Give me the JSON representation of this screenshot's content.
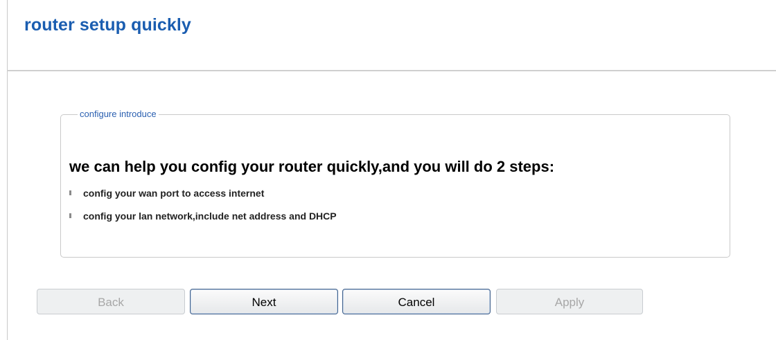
{
  "header": {
    "title": "router setup quickly"
  },
  "intro_section": {
    "legend": "configure introduce",
    "headline": "we can help you config your router quickly,and you will do 2 steps:",
    "steps": [
      "config your wan port to access internet",
      "config your lan network,include net address and DHCP"
    ]
  },
  "buttons": {
    "back": "Back",
    "next": "Next",
    "cancel": "Cancel",
    "apply": "Apply"
  },
  "colors": {
    "title": "#1a5db0",
    "legend": "#2a5fb0",
    "text": "#000000",
    "disabled_text": "#a7a7a7"
  }
}
